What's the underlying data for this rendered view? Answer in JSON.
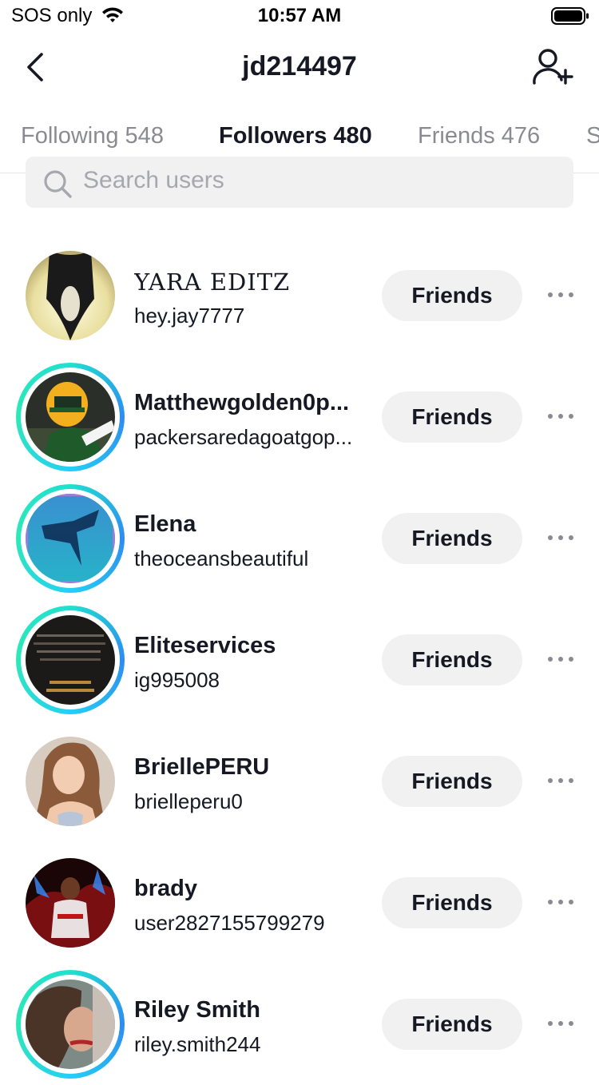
{
  "status_bar": {
    "carrier": "SOS only",
    "time": "10:57 AM"
  },
  "header": {
    "title": "jd214497"
  },
  "tabs": [
    {
      "label": "Following 548"
    },
    {
      "label": "Followers 480"
    },
    {
      "label": "Friends 476"
    },
    {
      "label": "S"
    }
  ],
  "search": {
    "placeholder": "Search users",
    "value": ""
  },
  "users": [
    {
      "name": "YARA EDITZ",
      "handle": "hey.jay7777",
      "button": "Friends",
      "story_ring": false,
      "avatar_icon": "profile-photo"
    },
    {
      "name": "Matthewgolden0p...",
      "handle": "packersaredagoatgop...",
      "button": "Friends",
      "story_ring": true,
      "avatar_icon": "profile-photo"
    },
    {
      "name": "Elena",
      "handle": "theoceansbeautiful",
      "button": "Friends",
      "story_ring": true,
      "avatar_icon": "profile-photo"
    },
    {
      "name": "Eliteservices",
      "handle": "ig995008",
      "button": "Friends",
      "story_ring": true,
      "avatar_icon": "profile-photo"
    },
    {
      "name": "BriellePERU",
      "handle": "brielleperu0",
      "button": "Friends",
      "story_ring": false,
      "avatar_icon": "profile-photo"
    },
    {
      "name": "brady",
      "handle": "user2827155799279",
      "button": "Friends",
      "story_ring": false,
      "avatar_icon": "profile-photo"
    },
    {
      "name": "Riley Smith",
      "handle": "riley.smith244",
      "button": "Friends",
      "story_ring": true,
      "avatar_icon": "profile-photo"
    }
  ],
  "colors": {
    "ring_start": "#1fe0d0",
    "ring_end": "#2d8cf0",
    "button_bg": "#f1f1f2",
    "text": "#161823",
    "muted": "#8a8b91"
  }
}
